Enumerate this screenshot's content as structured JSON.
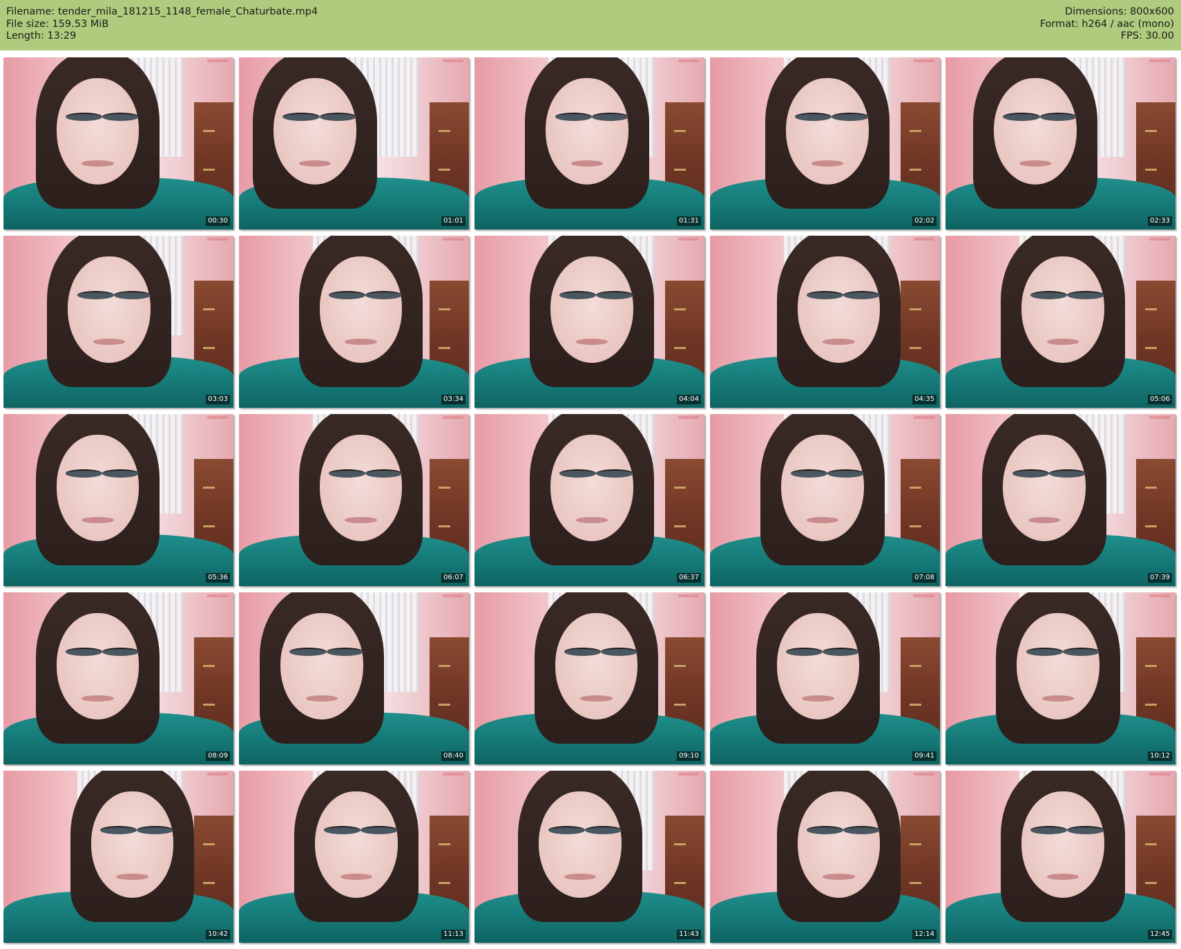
{
  "info": {
    "filename": "Filename: tender_mila_181215_1148_female_Chaturbate.mp4",
    "filesize": "File size: 159.53 MiB",
    "length": "Length: 13:29",
    "dimensions": "Dimensions: 800x600",
    "format": "Format: h264 / aac (mono)",
    "fps": "FPS: 30.00"
  },
  "colors": {
    "header_bg": "#afcb7d",
    "page_bg": "#ffffff"
  },
  "thumbnails": [
    {
      "timestamp": "00:30"
    },
    {
      "timestamp": "01:01"
    },
    {
      "timestamp": "01:31"
    },
    {
      "timestamp": "02:02"
    },
    {
      "timestamp": "02:33"
    },
    {
      "timestamp": "03:03"
    },
    {
      "timestamp": "03:34"
    },
    {
      "timestamp": "04:04"
    },
    {
      "timestamp": "04:35"
    },
    {
      "timestamp": "05:06"
    },
    {
      "timestamp": "05:36"
    },
    {
      "timestamp": "06:07"
    },
    {
      "timestamp": "06:37"
    },
    {
      "timestamp": "07:08"
    },
    {
      "timestamp": "07:39"
    },
    {
      "timestamp": "08:09"
    },
    {
      "timestamp": "08:40"
    },
    {
      "timestamp": "09:10"
    },
    {
      "timestamp": "09:41"
    },
    {
      "timestamp": "10:12"
    },
    {
      "timestamp": "10:42"
    },
    {
      "timestamp": "11:13"
    },
    {
      "timestamp": "11:43"
    },
    {
      "timestamp": "12:14"
    },
    {
      "timestamp": "12:45"
    }
  ]
}
